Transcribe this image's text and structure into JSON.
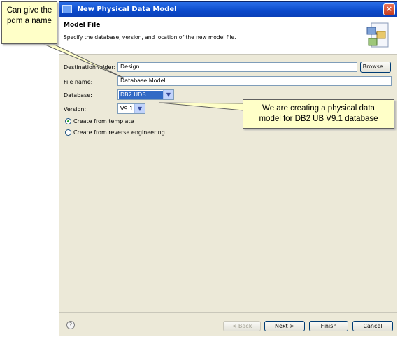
{
  "window": {
    "title": "New Physical Data Model",
    "close_label": "×"
  },
  "header": {
    "title": "Model File",
    "description": "Specify the database, version, and location of the new model file."
  },
  "form": {
    "destination_label": "Destination folder:",
    "destination_value": "Design",
    "browse_label": "Browse...",
    "filename_label": "File name:",
    "filename_value": "Database Model",
    "database_label": "Database:",
    "database_value": "DB2 UDB",
    "version_label": "Version:",
    "version_value": "V9.1",
    "radio_template": "Create from template",
    "radio_reverse": "Create from reverse engineering",
    "radio_selected": "template"
  },
  "footer": {
    "help": "?",
    "back": "< Back",
    "next": "Next >",
    "finish": "Finish",
    "cancel": "Cancel"
  },
  "callouts": {
    "left_line1": "Can give the",
    "left_line2": "pdm a name",
    "right_line1": "We are creating a physical data",
    "right_line2": "model for DB2 UB V9.1 database"
  },
  "colors": {
    "callout_fill": "#ffffc8",
    "title_bar": "#0a48c9",
    "selection": "#316ac5"
  }
}
